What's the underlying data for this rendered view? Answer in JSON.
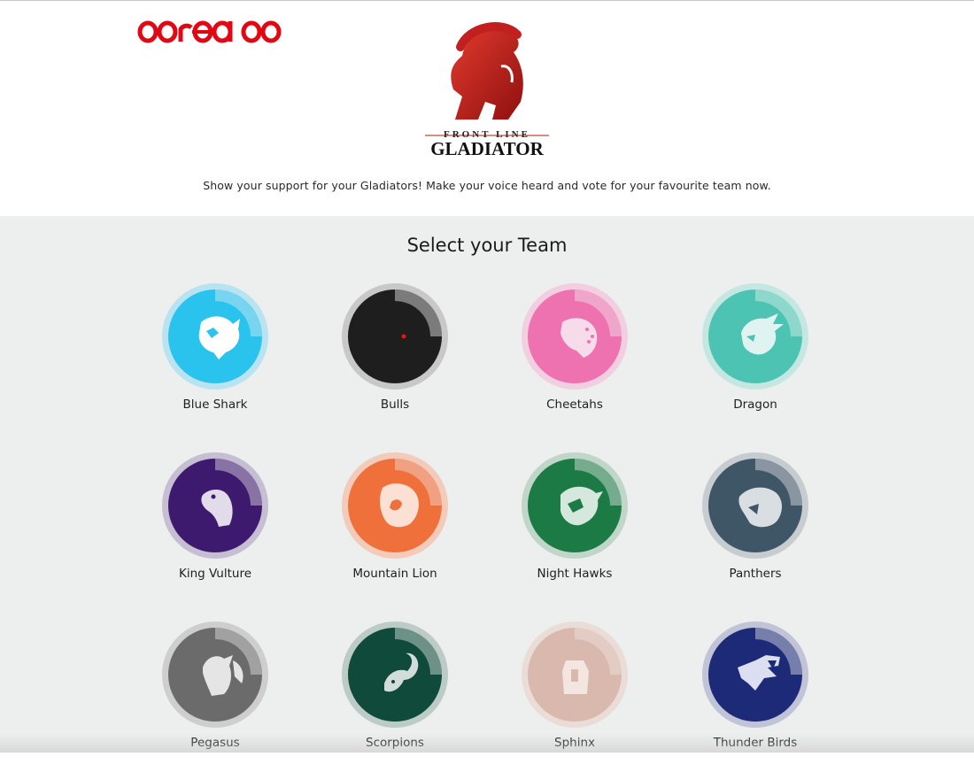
{
  "header": {
    "brand": "ooredoo",
    "brand_color": "#e30613",
    "logo_top": "FRONT LINE",
    "logo_bottom": "GLADIATOR",
    "logo_color": "#b51a1a",
    "tagline": "Show your support for your Gladiators! Make your voice heard and vote for your favourite team now."
  },
  "section": {
    "title": "Select your Team"
  },
  "teams": [
    {
      "name": "Blue Shark",
      "icon": "shark-icon",
      "color": "#29c3ee",
      "ring": "#b9e3f1"
    },
    {
      "name": "Bulls",
      "icon": "bull-icon",
      "color": "#1e1e1e",
      "ring": "#c8c8c8"
    },
    {
      "name": "Cheetahs",
      "icon": "cheetah-icon",
      "color": "#ee72b0",
      "ring": "#f2cfe0"
    },
    {
      "name": "Dragon",
      "icon": "dragon-icon",
      "color": "#4cc3b3",
      "ring": "#c4e7e2"
    },
    {
      "name": "King Vulture",
      "icon": "vulture-icon",
      "color": "#3e1a6e",
      "ring": "#c6bed2"
    },
    {
      "name": "Mountain Lion",
      "icon": "lion-icon",
      "color": "#f0703c",
      "ring": "#f3cbbb"
    },
    {
      "name": "Night Hawks",
      "icon": "hawk-icon",
      "color": "#1c7a45",
      "ring": "#c0d6c9"
    },
    {
      "name": "Panthers",
      "icon": "panther-icon",
      "color": "#3f5666",
      "ring": "#c7ccd1"
    },
    {
      "name": "Pegasus",
      "icon": "pegasus-icon",
      "color": "#6b6b6b",
      "ring": "#cecece"
    },
    {
      "name": "Scorpions",
      "icon": "scorpion-icon",
      "color": "#0f4a3a",
      "ring": "#bccbc6"
    },
    {
      "name": "Sphinx",
      "icon": "sphinx-icon",
      "color": "#d9b9ae",
      "ring": "#eadcd7"
    },
    {
      "name": "Thunder Birds",
      "icon": "thunderbird-icon",
      "color": "#1c2a78",
      "ring": "#c1c4d6"
    }
  ]
}
